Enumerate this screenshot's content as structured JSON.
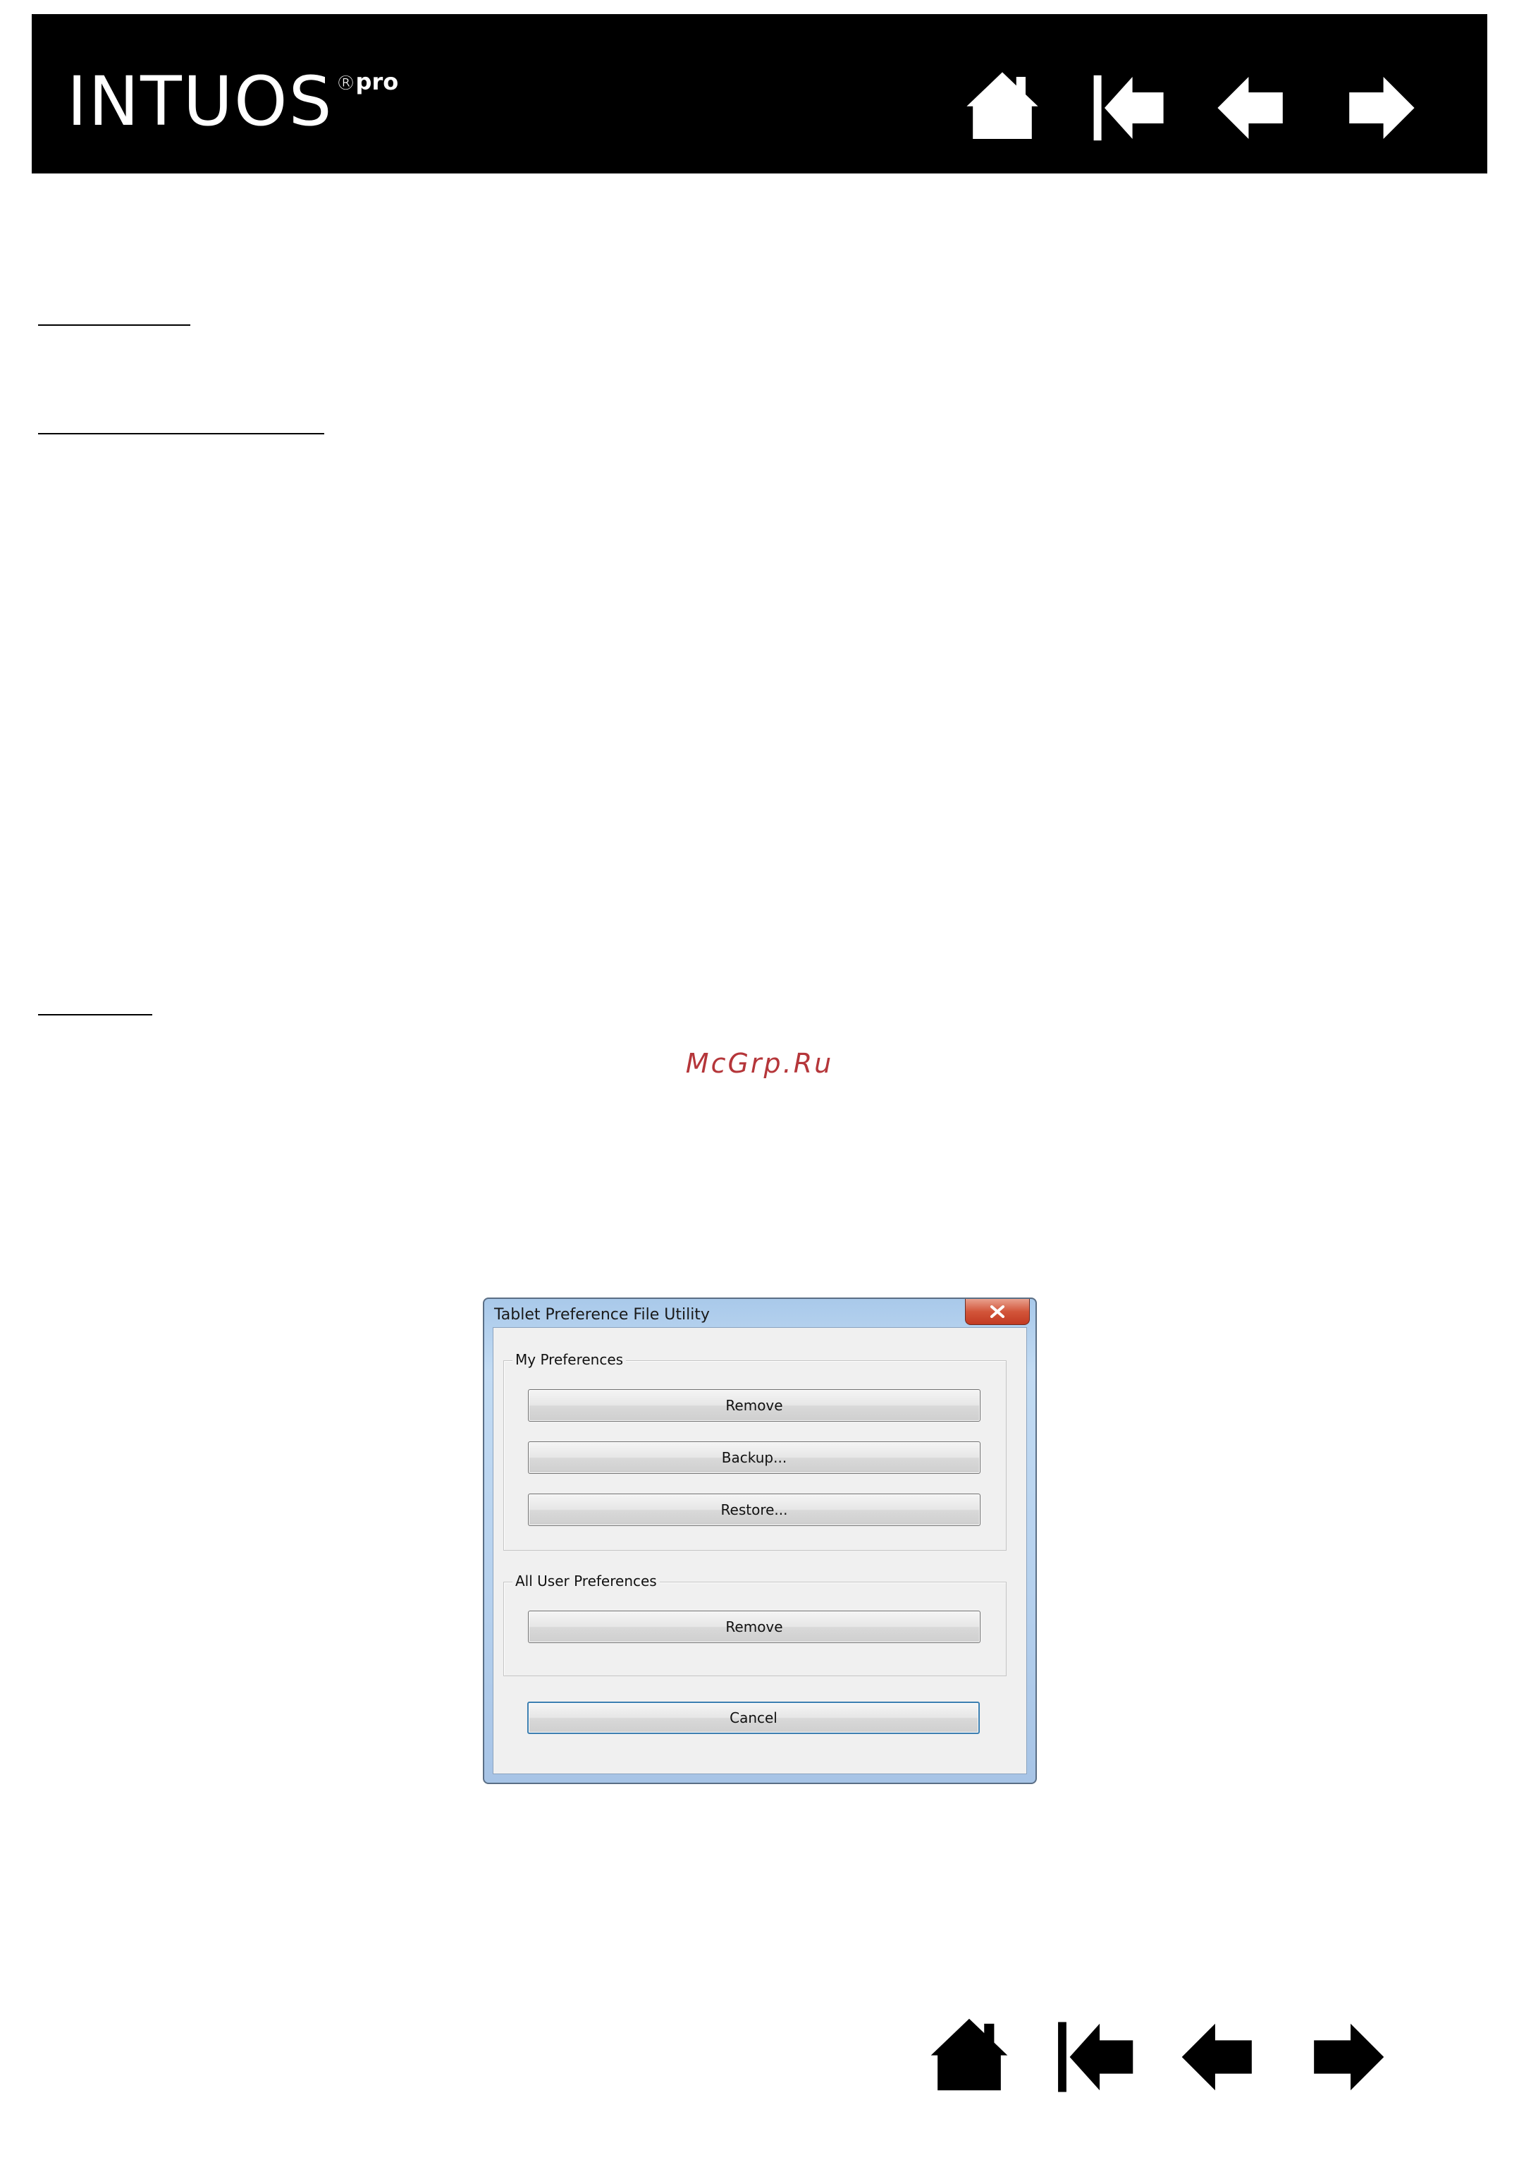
{
  "header": {
    "brand": "INTUOS",
    "brand_reg": "®",
    "brand_sup": "pro",
    "bg_color": "#000000"
  },
  "nav": {
    "icons": [
      "home-icon",
      "first-page-icon",
      "previous-page-icon",
      "next-page-icon"
    ]
  },
  "watermark": {
    "text": "McGrp.Ru",
    "color": "#b5363a"
  },
  "dialog": {
    "title": "Tablet Preference File Utility",
    "close_glyph": "x",
    "my_preferences": {
      "label": "My Preferences",
      "remove_label": "Remove",
      "backup_label": "Backup...",
      "restore_label": "Restore..."
    },
    "all_user_preferences": {
      "label": "All User Preferences",
      "remove_label": "Remove"
    },
    "cancel_label": "Cancel"
  }
}
